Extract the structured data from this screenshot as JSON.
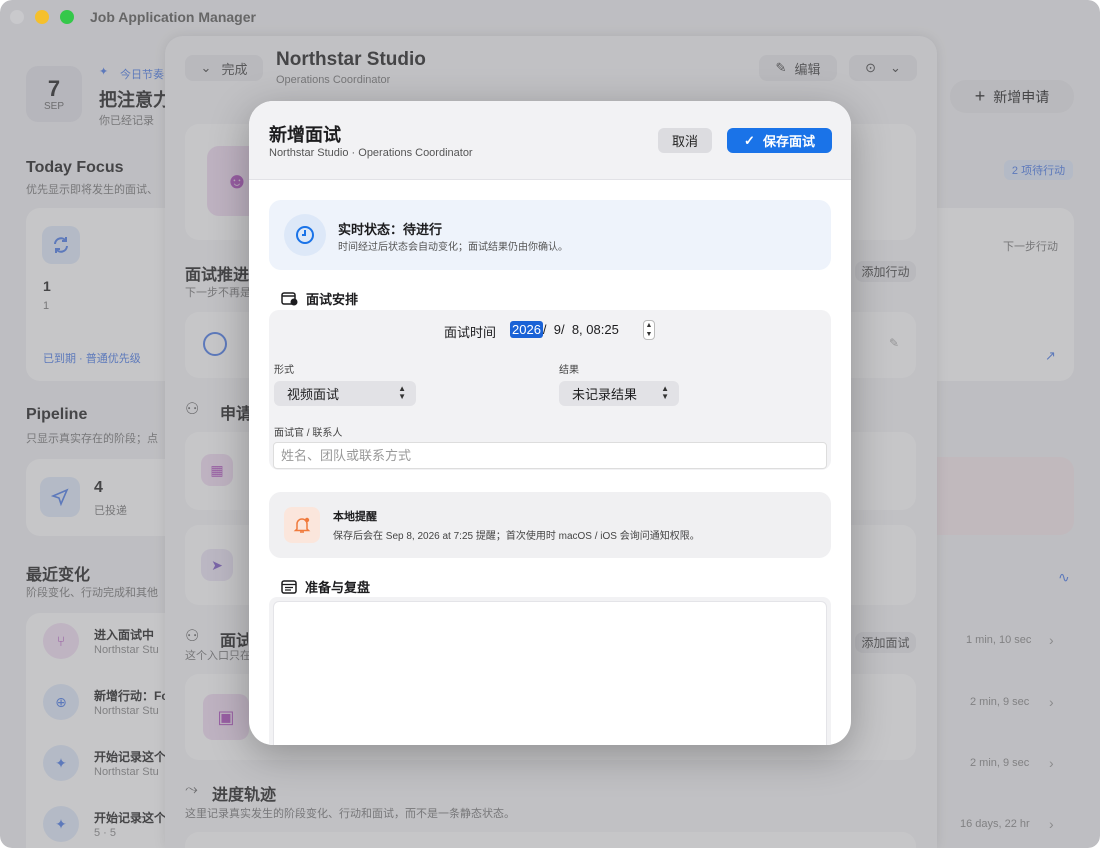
{
  "window": {
    "title": "Job Application Manager"
  },
  "sidebar": {
    "date": {
      "day": "7",
      "month": "SEP"
    },
    "rhythm_label": "今日节奏",
    "rhythm_title": "把注意力",
    "rhythm_sub": "你已经记录",
    "today_focus": {
      "title": "Today Focus",
      "subtitle": "优先显示即将发生的面试、",
      "count": "1",
      "count_sub": "1",
      "tag": "已到期 · 普通优先级"
    },
    "pipeline": {
      "title": "Pipeline",
      "subtitle": "只显示真实存在的阶段；点",
      "count": "4",
      "label": "已投递"
    },
    "recent": {
      "title": "最近变化",
      "subtitle": "阶段变化、行动完成和其他",
      "items": [
        {
          "title": "进入面试中",
          "sub": "Northstar Stu"
        },
        {
          "title": "新增行动：Fo",
          "sub": "Northstar Stu"
        },
        {
          "title": "开始记录这个",
          "sub": "Northstar Stu"
        },
        {
          "title": "开始记录这个",
          "sub": "5 · 5"
        }
      ]
    }
  },
  "detail": {
    "done_label": "完成",
    "company": "Northstar Studio",
    "role": "Operations Coordinator",
    "edit_label": "编辑",
    "interview_progress": {
      "title": "面试推进",
      "sub": "下一步不再是"
    },
    "application_section": "申请",
    "interview_section": {
      "title": "面试",
      "sub": "这个入口只在"
    },
    "add_action_label": "添加行动",
    "add_interview_label": "添加面试",
    "track": {
      "title": "进度轨迹",
      "subtitle": "这里记录真实发生的阶段变化、行动和面试，而不是一条静态状态。"
    }
  },
  "right": {
    "new_application_label": "新增申请",
    "pending_badge": "2 项待行动",
    "next_action_label": "下一步行动",
    "times": [
      "1 min, 10 sec",
      "2 min, 9 sec",
      "2 min, 9 sec",
      "16 days, 22 hr"
    ]
  },
  "modal": {
    "title": "新增面试",
    "subtitle": "Northstar Studio · Operations Coordinator",
    "cancel_label": "取消",
    "save_label": "保存面试",
    "status": {
      "title": "实时状态：待进行",
      "desc": "时间经过后状态会自动变化；面试结果仍由你确认。"
    },
    "schedule": {
      "title": "面试安排",
      "datetime_label": "面试时间",
      "year": "2026",
      "date_rest": "/  9/  8, 08:25",
      "format_label": "形式",
      "format_value": "视频面试",
      "result_label": "结果",
      "result_value": "未记录结果",
      "interviewer_label": "面试官 / 联系人",
      "interviewer_placeholder": "姓名、团队或联系方式"
    },
    "reminder": {
      "title": "本地提醒",
      "desc": "保存后会在 Sep 8, 2026 at 7:25 提醒；首次使用时 macOS / iOS 会询问通知权限。"
    },
    "notes": {
      "title": "准备与复盘"
    }
  },
  "colors": {
    "accent": "#1a73e8",
    "status_bg": "#eef3fb",
    "reminder_icon": "#f07a3c"
  }
}
